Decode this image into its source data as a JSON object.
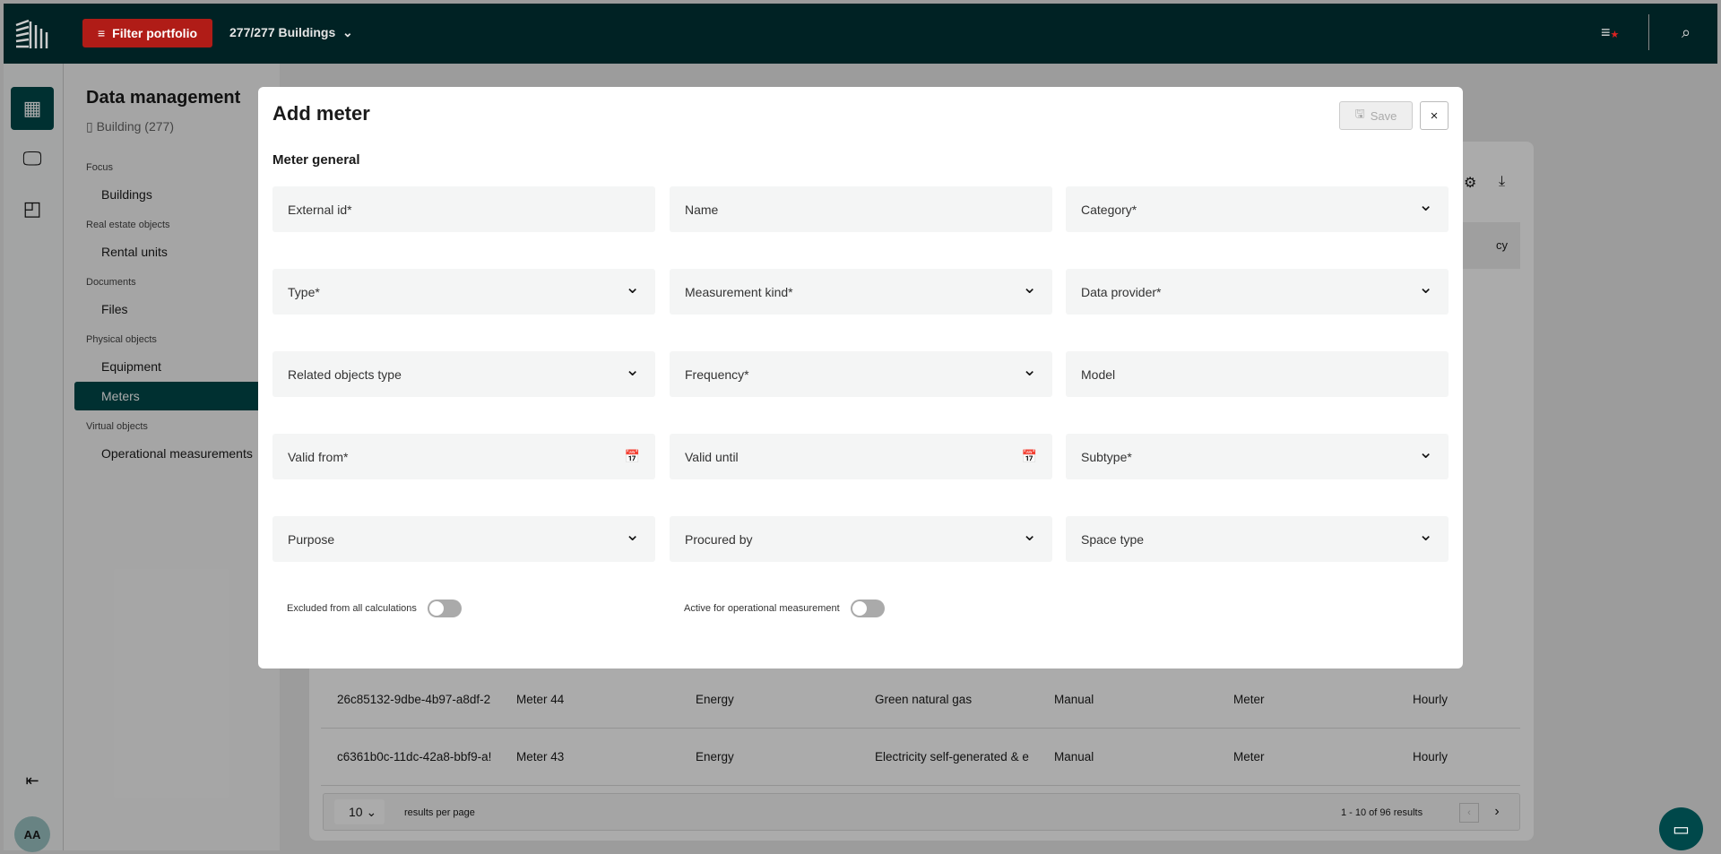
{
  "topbar": {
    "filter_label": "Filter portfolio",
    "buildings_label": "277/277 Buildings"
  },
  "rail": {
    "avatar": "AA"
  },
  "sidebar": {
    "title": "Data management",
    "subtitle": "Building (277)",
    "groups": [
      {
        "label": "Focus",
        "items": [
          "Buildings"
        ]
      },
      {
        "label": "Real estate objects",
        "items": [
          "Rental units"
        ]
      },
      {
        "label": "Documents",
        "items": [
          "Files"
        ]
      },
      {
        "label": "Physical objects",
        "items": [
          "Equipment",
          "Meters"
        ]
      },
      {
        "label": "Virtual objects",
        "items": [
          "Operational measurements"
        ]
      }
    ],
    "active_item": "Meters"
  },
  "table": {
    "header_partial": "cy",
    "rows": [
      [
        "26c85132-9dbe-4b97-a8df-2",
        "Meter 44",
        "Energy",
        "Green natural gas",
        "Manual",
        "Meter",
        "Hourly"
      ],
      [
        "c6361b0c-11dc-42a8-bbf9-a!",
        "Meter 43",
        "Energy",
        "Electricity self-generated & e",
        "Manual",
        "Meter",
        "Hourly"
      ]
    ],
    "page_size": "10",
    "per_page_label": "results per page",
    "range_label": "1 - 10 of  96 results"
  },
  "modal": {
    "title": "Add meter",
    "save_label": "Save",
    "close_label": "×",
    "section": "Meter general",
    "fields": [
      {
        "label": "External id*",
        "icon": ""
      },
      {
        "label": "Name",
        "icon": ""
      },
      {
        "label": "Category*",
        "icon": "chevron-down"
      },
      {
        "label": "Type*",
        "icon": "chevron-down"
      },
      {
        "label": "Measurement kind*",
        "icon": "chevron-down"
      },
      {
        "label": "Data provider*",
        "icon": "chevron-down"
      },
      {
        "label": "Related objects type",
        "icon": "chevron-down"
      },
      {
        "label": "Frequency*",
        "icon": "chevron-down"
      },
      {
        "label": "Model",
        "icon": ""
      },
      {
        "label": "Valid from*",
        "icon": "calendar"
      },
      {
        "label": "Valid until",
        "icon": "calendar"
      },
      {
        "label": "Subtype*",
        "icon": "chevron-down"
      },
      {
        "label": "Purpose",
        "icon": "chevron-down"
      },
      {
        "label": "Procured by",
        "icon": "chevron-down"
      },
      {
        "label": "Space type",
        "icon": "chevron-down"
      }
    ],
    "toggles": [
      {
        "label": "Excluded from all calculations",
        "on": false
      },
      {
        "label": "Active for operational measurement",
        "on": false
      }
    ]
  }
}
